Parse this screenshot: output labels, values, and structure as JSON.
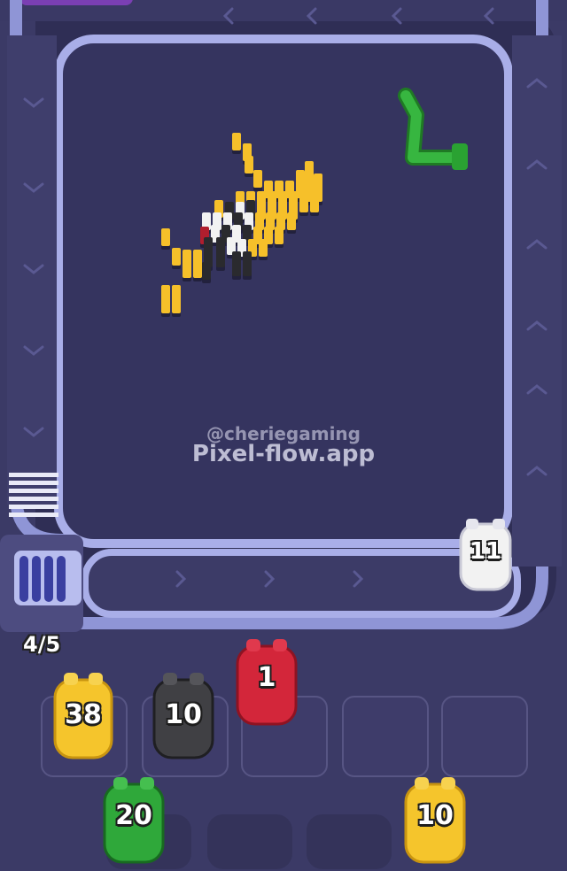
{
  "watermark": {
    "handle": "@cheriegaming",
    "site": "Pixel-flow.app"
  },
  "queue": {
    "count": "4/5"
  },
  "conveyor_pig": {
    "value": "11",
    "color": "#f2f2f2"
  },
  "pigs": [
    {
      "id": "yellow-38",
      "value": "38",
      "color": "#f5c52c",
      "place": "slot-1"
    },
    {
      "id": "black-10",
      "value": "10",
      "color": "#404044",
      "place": "slot-2"
    },
    {
      "id": "red-1",
      "value": "1",
      "color": "#d3263a",
      "place": "column-3-top"
    },
    {
      "id": "green-20",
      "value": "20",
      "color": "#2fa83a",
      "place": "column-1-bottom"
    },
    {
      "id": "yellow-10",
      "value": "10",
      "color": "#f5c52c",
      "place": "column-4-bottom"
    }
  ],
  "slots": [
    {
      "state": "filled"
    },
    {
      "state": "filled"
    },
    {
      "state": "empty"
    },
    {
      "state": "empty"
    },
    {
      "state": "empty"
    }
  ],
  "colors": {
    "background": "#3b3a66",
    "board": "#3c3b65",
    "track": "#9fa4e0",
    "pixel_yellow": "#f6c02a",
    "pixel_white": "#f2f2f2",
    "pixel_black": "#2a2a2e",
    "pixel_red": "#b01e2e"
  }
}
